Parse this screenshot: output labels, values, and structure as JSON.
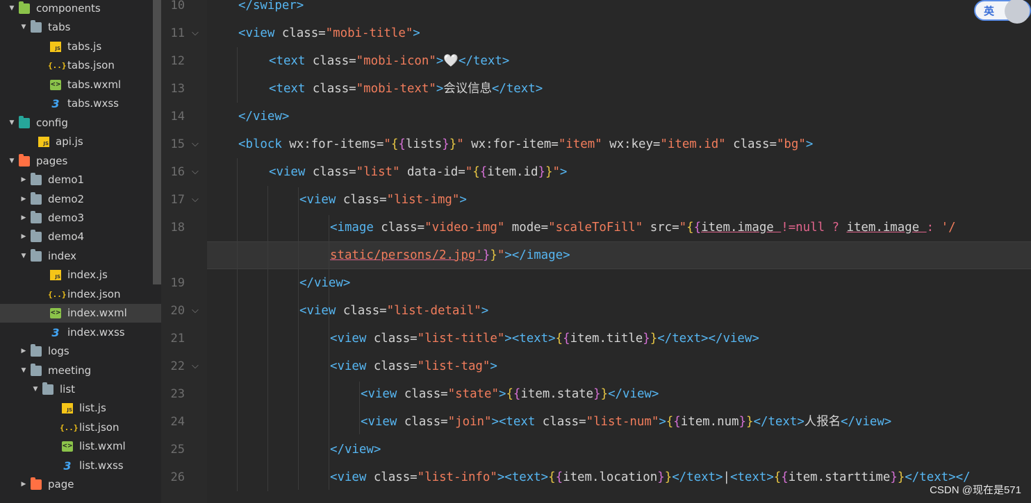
{
  "sidebar": {
    "items": [
      {
        "label": "components",
        "icon": "folder-icon",
        "level": 0,
        "expanded": true,
        "type": "folder-green"
      },
      {
        "label": "tabs",
        "icon": "folder-icon",
        "level": 1,
        "expanded": true,
        "type": "folder"
      },
      {
        "label": "tabs.js",
        "icon": "js-file-icon",
        "level": 2,
        "type": "js"
      },
      {
        "label": "tabs.json",
        "icon": "json-file-icon",
        "level": 2,
        "type": "json"
      },
      {
        "label": "tabs.wxml",
        "icon": "wxml-file-icon",
        "level": 2,
        "type": "wxml"
      },
      {
        "label": "tabs.wxss",
        "icon": "wxss-file-icon",
        "level": 2,
        "type": "wxss"
      },
      {
        "label": "config",
        "icon": "folder-icon",
        "level": 0,
        "expanded": true,
        "type": "folder-teal"
      },
      {
        "label": "api.js",
        "icon": "js-file-icon",
        "level": 1,
        "type": "js"
      },
      {
        "label": "pages",
        "icon": "folder-icon",
        "level": 0,
        "expanded": true,
        "type": "folder-orange"
      },
      {
        "label": "demo1",
        "icon": "folder-icon",
        "level": 1,
        "expanded": false,
        "type": "folder"
      },
      {
        "label": "demo2",
        "icon": "folder-icon",
        "level": 1,
        "expanded": false,
        "type": "folder"
      },
      {
        "label": "demo3",
        "icon": "folder-icon",
        "level": 1,
        "expanded": false,
        "type": "folder"
      },
      {
        "label": "demo4",
        "icon": "folder-icon",
        "level": 1,
        "expanded": false,
        "type": "folder"
      },
      {
        "label": "index",
        "icon": "folder-icon",
        "level": 1,
        "expanded": true,
        "type": "folder"
      },
      {
        "label": "index.js",
        "icon": "js-file-icon",
        "level": 2,
        "type": "js"
      },
      {
        "label": "index.json",
        "icon": "json-file-icon",
        "level": 2,
        "type": "json"
      },
      {
        "label": "index.wxml",
        "icon": "wxml-file-icon",
        "level": 2,
        "type": "wxml",
        "active": true
      },
      {
        "label": "index.wxss",
        "icon": "wxss-file-icon",
        "level": 2,
        "type": "wxss"
      },
      {
        "label": "logs",
        "icon": "folder-icon",
        "level": 1,
        "expanded": false,
        "type": "folder"
      },
      {
        "label": "meeting",
        "icon": "folder-icon",
        "level": 1,
        "expanded": true,
        "type": "folder"
      },
      {
        "label": "list",
        "icon": "folder-icon",
        "level": 2,
        "expanded": true,
        "type": "folder"
      },
      {
        "label": "list.js",
        "icon": "js-file-icon",
        "level": 3,
        "type": "js"
      },
      {
        "label": "list.json",
        "icon": "json-file-icon",
        "level": 3,
        "type": "json"
      },
      {
        "label": "list.wxml",
        "icon": "wxml-file-icon",
        "level": 3,
        "type": "wxml"
      },
      {
        "label": "list.wxss",
        "icon": "wxss-file-icon",
        "level": 3,
        "type": "wxss"
      },
      {
        "label": "page",
        "icon": "folder-icon",
        "level": 1,
        "expanded": false,
        "type": "folder-orange"
      }
    ]
  },
  "editor": {
    "line_numbers": [
      "10",
      "11",
      "12",
      "13",
      "14",
      "15",
      "16",
      "17",
      "18",
      "",
      "19",
      "20",
      "21",
      "22",
      "23",
      "24",
      "25",
      "26"
    ],
    "fold_lines": [
      "11",
      "15",
      "16",
      "17",
      "20",
      "22"
    ],
    "lines": [
      [
        [
          "t",
          "</swiper>"
        ]
      ],
      [
        [
          "t",
          "<view "
        ],
        [
          "a",
          "class="
        ],
        [
          "s",
          "\"mobi-title\""
        ],
        [
          "t",
          ">"
        ]
      ],
      [
        [
          "t",
          "<text "
        ],
        [
          "a",
          "class="
        ],
        [
          "s",
          "\"mobi-icon\""
        ],
        [
          "t",
          ">"
        ],
        [
          "x",
          "🤍"
        ],
        [
          "t",
          "</text>"
        ]
      ],
      [
        [
          "t",
          "<text "
        ],
        [
          "a",
          "class="
        ],
        [
          "s",
          "\"mobi-text\""
        ],
        [
          "t",
          ">"
        ],
        [
          "x",
          "会议信息"
        ],
        [
          "t",
          "</text>"
        ]
      ],
      [
        [
          "t",
          "</view>"
        ]
      ],
      [
        [
          "t",
          "<block "
        ],
        [
          "a",
          "wx:for-items="
        ],
        [
          "s",
          "\""
        ],
        [
          "b",
          "{"
        ],
        [
          "b2",
          "{"
        ],
        [
          "x",
          "lists"
        ],
        [
          "b2",
          "}"
        ],
        [
          "b",
          "}"
        ],
        [
          "s",
          "\""
        ],
        [
          "a",
          " wx:for-item="
        ],
        [
          "s",
          "\"item\""
        ],
        [
          "a",
          " wx:key="
        ],
        [
          "s",
          "\"item.id\""
        ],
        [
          "a",
          " class="
        ],
        [
          "s",
          "\"bg\""
        ],
        [
          "t",
          ">"
        ]
      ],
      [
        [
          "t",
          "<view "
        ],
        [
          "a",
          "class="
        ],
        [
          "s",
          "\"list\""
        ],
        [
          "a",
          " data-id="
        ],
        [
          "s",
          "\""
        ],
        [
          "b",
          "{"
        ],
        [
          "b2",
          "{"
        ],
        [
          "x",
          "item.id"
        ],
        [
          "b2",
          "}"
        ],
        [
          "b",
          "}"
        ],
        [
          "s",
          "\""
        ],
        [
          "t",
          ">"
        ]
      ],
      [
        [
          "t",
          "<view "
        ],
        [
          "a",
          "class="
        ],
        [
          "s",
          "\"list-img\""
        ],
        [
          "t",
          ">"
        ]
      ],
      [
        [
          "t",
          "<image "
        ],
        [
          "a",
          "class="
        ],
        [
          "s",
          "\"video-img\""
        ],
        [
          "a",
          " mode="
        ],
        [
          "s",
          "\"scaleToFill\""
        ],
        [
          "a",
          " src="
        ],
        [
          "s",
          "\""
        ],
        [
          "b",
          "{"
        ],
        [
          "b2",
          "{"
        ],
        [
          "xu",
          "item.image "
        ],
        [
          "o",
          "!=null ? "
        ],
        [
          "xu",
          "item.image "
        ],
        [
          "o",
          ": "
        ],
        [
          "s",
          "'/"
        ]
      ],
      [
        [
          "su",
          "static/persons/2.jpg'"
        ],
        [
          "b2",
          "}"
        ],
        [
          "b",
          "}"
        ],
        [
          "s",
          "\""
        ],
        [
          "t",
          "></image>"
        ]
      ],
      [
        [
          "t",
          "</view>"
        ]
      ],
      [
        [
          "t",
          "<view "
        ],
        [
          "a",
          "class="
        ],
        [
          "s",
          "\"list-detail\""
        ],
        [
          "t",
          ">"
        ]
      ],
      [
        [
          "t",
          "<view "
        ],
        [
          "a",
          "class="
        ],
        [
          "s",
          "\"list-title\""
        ],
        [
          "t",
          "><text>"
        ],
        [
          "b",
          "{"
        ],
        [
          "b2",
          "{"
        ],
        [
          "x",
          "item.title"
        ],
        [
          "b2",
          "}"
        ],
        [
          "b",
          "}"
        ],
        [
          "t",
          "</text></view>"
        ]
      ],
      [
        [
          "t",
          "<view "
        ],
        [
          "a",
          "class="
        ],
        [
          "s",
          "\"list-tag\""
        ],
        [
          "t",
          ">"
        ]
      ],
      [
        [
          "t",
          "<view "
        ],
        [
          "a",
          "class="
        ],
        [
          "s",
          "\"state\""
        ],
        [
          "t",
          ">"
        ],
        [
          "b",
          "{"
        ],
        [
          "b2",
          "{"
        ],
        [
          "x",
          "item.state"
        ],
        [
          "b2",
          "}"
        ],
        [
          "b",
          "}"
        ],
        [
          "t",
          "</view>"
        ]
      ],
      [
        [
          "t",
          "<view "
        ],
        [
          "a",
          "class="
        ],
        [
          "s",
          "\"join\""
        ],
        [
          "t",
          "><text "
        ],
        [
          "a",
          "class="
        ],
        [
          "s",
          "\"list-num\""
        ],
        [
          "t",
          ">"
        ],
        [
          "b",
          "{"
        ],
        [
          "b2",
          "{"
        ],
        [
          "x",
          "item.num"
        ],
        [
          "b2",
          "}"
        ],
        [
          "b",
          "}"
        ],
        [
          "t",
          "</text>"
        ],
        [
          "x",
          "人报名"
        ],
        [
          "t",
          "</view>"
        ]
      ],
      [
        [
          "t",
          "</view>"
        ]
      ],
      [
        [
          "t",
          "<view "
        ],
        [
          "a",
          "class="
        ],
        [
          "s",
          "\"list-info\""
        ],
        [
          "t",
          "><text>"
        ],
        [
          "b",
          "{"
        ],
        [
          "b2",
          "{"
        ],
        [
          "x",
          "item.location"
        ],
        [
          "b2",
          "}"
        ],
        [
          "b",
          "}"
        ],
        [
          "t",
          "</text>"
        ],
        [
          "x",
          "|"
        ],
        [
          "t",
          "<text>"
        ],
        [
          "b",
          "{"
        ],
        [
          "b2",
          "{"
        ],
        [
          "x",
          "item.starttime"
        ],
        [
          "b2",
          "}"
        ],
        [
          "b",
          "}"
        ],
        [
          "t",
          "</text></"
        ]
      ]
    ]
  },
  "ime": {
    "label": "英"
  },
  "watermark": "CSDN @现在是571"
}
